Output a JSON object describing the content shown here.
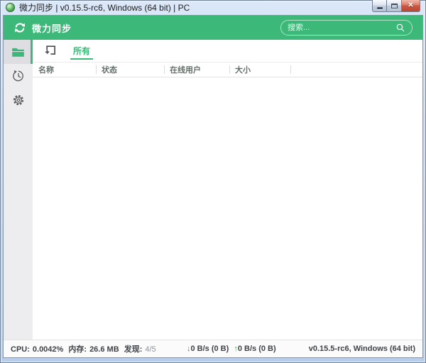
{
  "colors": {
    "accent_green": "#3cb878",
    "down_blue": "#2f7fd3",
    "up_green": "#3faf4e"
  },
  "window": {
    "title": "微力同步 | v0.15.5-rc6, Windows (64 bit) | PC"
  },
  "header": {
    "app_name": "微力同步",
    "search_placeholder": "搜索..."
  },
  "sidebar": {
    "items": [
      {
        "id": "folders",
        "active": true
      },
      {
        "id": "history",
        "active": false
      },
      {
        "id": "settings",
        "active": false
      }
    ]
  },
  "toolbar": {
    "tab_all": "所有"
  },
  "table": {
    "columns": [
      "名称",
      "状态",
      "在线用户",
      "大小"
    ],
    "rows": []
  },
  "statusbar": {
    "cpu_label": "CPU:",
    "cpu_value": "0.0042%",
    "mem_label": "内存:",
    "mem_value": "26.6 MB",
    "found_label": "发现:",
    "found_value": "4/5",
    "down_arrow": "↓",
    "down_text": "0 B/s (0 B)",
    "up_arrow": "↑",
    "up_text": "0 B/s (0 B)",
    "version": "v0.15.5-rc6, Windows (64 bit)"
  }
}
